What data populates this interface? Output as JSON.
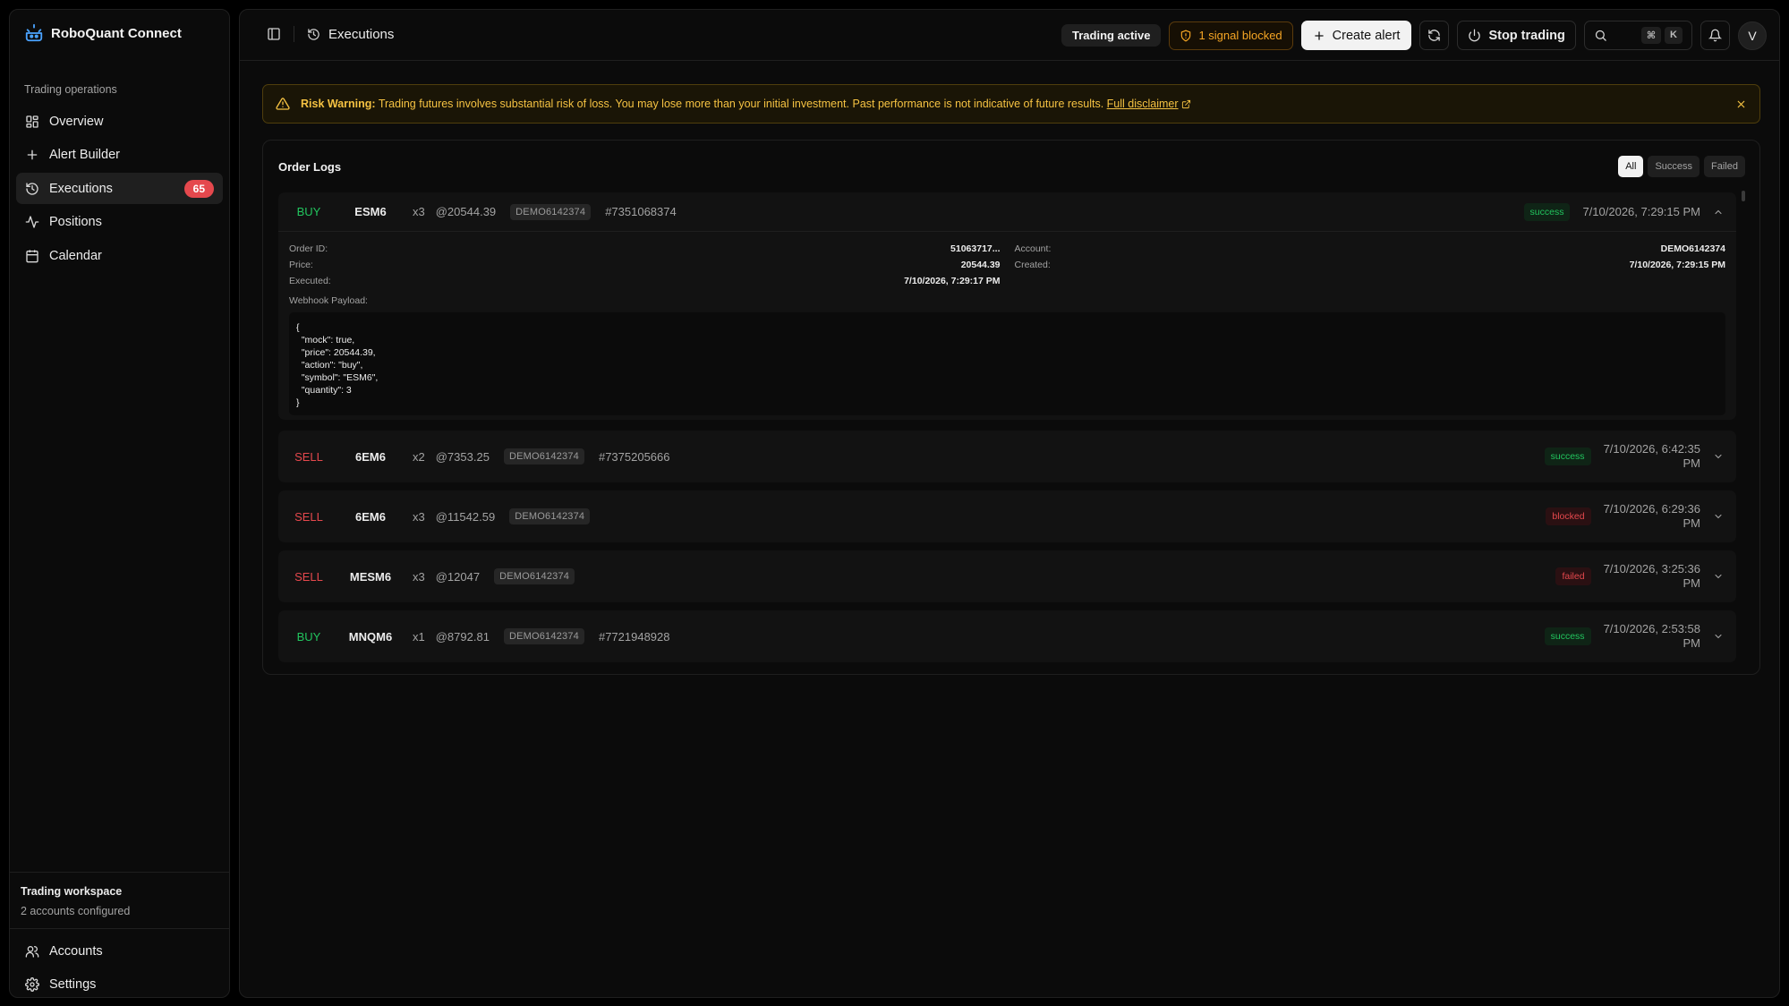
{
  "brand": {
    "name": "RoboQuant Connect"
  },
  "sidebar": {
    "group_label": "Trading operations",
    "items": [
      {
        "label": "Overview",
        "icon": "grid-icon"
      },
      {
        "label": "Alert Builder",
        "icon": "plus-icon"
      },
      {
        "label": "Executions",
        "icon": "history-icon",
        "badge": "65",
        "active": true
      },
      {
        "label": "Positions",
        "icon": "activity-icon"
      },
      {
        "label": "Calendar",
        "icon": "calendar-icon"
      }
    ],
    "workspace": {
      "title": "Trading workspace",
      "subtitle": "2 accounts configured"
    },
    "bottom_items": [
      {
        "label": "Accounts",
        "icon": "users-icon"
      },
      {
        "label": "Settings",
        "icon": "gear-icon"
      }
    ]
  },
  "header": {
    "page_title": "Executions",
    "status_pill": "Trading active",
    "blocked_pill": "1 signal blocked",
    "create_alert_label": "Create alert",
    "stop_trading_label": "Stop trading",
    "kbd_cmd": "⌘",
    "kbd_k": "K",
    "avatar_initial": "V"
  },
  "warning": {
    "title": "Risk Warning:",
    "text": "Trading futures involves substantial risk of loss. You may lose more than your initial investment. Past performance is not indicative of future results.",
    "link": "Full disclaimer"
  },
  "order_logs": {
    "title": "Order Logs",
    "filters": [
      "All",
      "Success",
      "Failed"
    ],
    "active_filter": "All",
    "details_labels": {
      "order_id": "Order ID:",
      "price": "Price:",
      "executed": "Executed:",
      "account": "Account:",
      "created": "Created:",
      "webhook": "Webhook Payload:"
    },
    "orders": [
      {
        "side": "BUY",
        "symbol": "ESM6",
        "qty": "x3",
        "price": "@20544.39",
        "account": "DEMO6142374",
        "order_no": "#7351068374",
        "status": "success",
        "time": "7/10/2026, 7:29:15 PM",
        "expanded": true,
        "details": {
          "order_id": "51063717...",
          "price": "20544.39",
          "executed": "7/10/2026, 7:29:17 PM",
          "account": "DEMO6142374",
          "created": "7/10/2026, 7:29:15 PM",
          "payload": "{\n  \"mock\": true,\n  \"price\": 20544.39,\n  \"action\": \"buy\",\n  \"symbol\": \"ESM6\",\n  \"quantity\": 3\n}"
        }
      },
      {
        "side": "SELL",
        "symbol": "6EM6",
        "qty": "x2",
        "price": "@7353.25",
        "account": "DEMO6142374",
        "order_no": "#7375205666",
        "status": "success",
        "time_line1": "7/10/2026, 6:42:35",
        "time_line2": "PM"
      },
      {
        "side": "SELL",
        "symbol": "6EM6",
        "qty": "x3",
        "price": "@11542.59",
        "account": "DEMO6142374",
        "order_no": "",
        "status": "blocked",
        "time_line1": "7/10/2026, 6:29:36",
        "time_line2": "PM"
      },
      {
        "side": "SELL",
        "symbol": "MESM6",
        "qty": "x3",
        "price": "@12047",
        "account": "DEMO6142374",
        "order_no": "",
        "status": "failed",
        "time_line1": "7/10/2026, 3:25:36",
        "time_line2": "PM"
      },
      {
        "side": "BUY",
        "symbol": "MNQM6",
        "qty": "x1",
        "price": "@8792.81",
        "account": "DEMO6142374",
        "order_no": "#7721948928",
        "status": "success",
        "time_line1": "7/10/2026, 2:53:58",
        "time_line2": "PM"
      }
    ]
  },
  "colors": {
    "buy": "#22c55e",
    "sell": "#e5484d",
    "warning": "#f5c242",
    "badge": "#e5484d"
  }
}
